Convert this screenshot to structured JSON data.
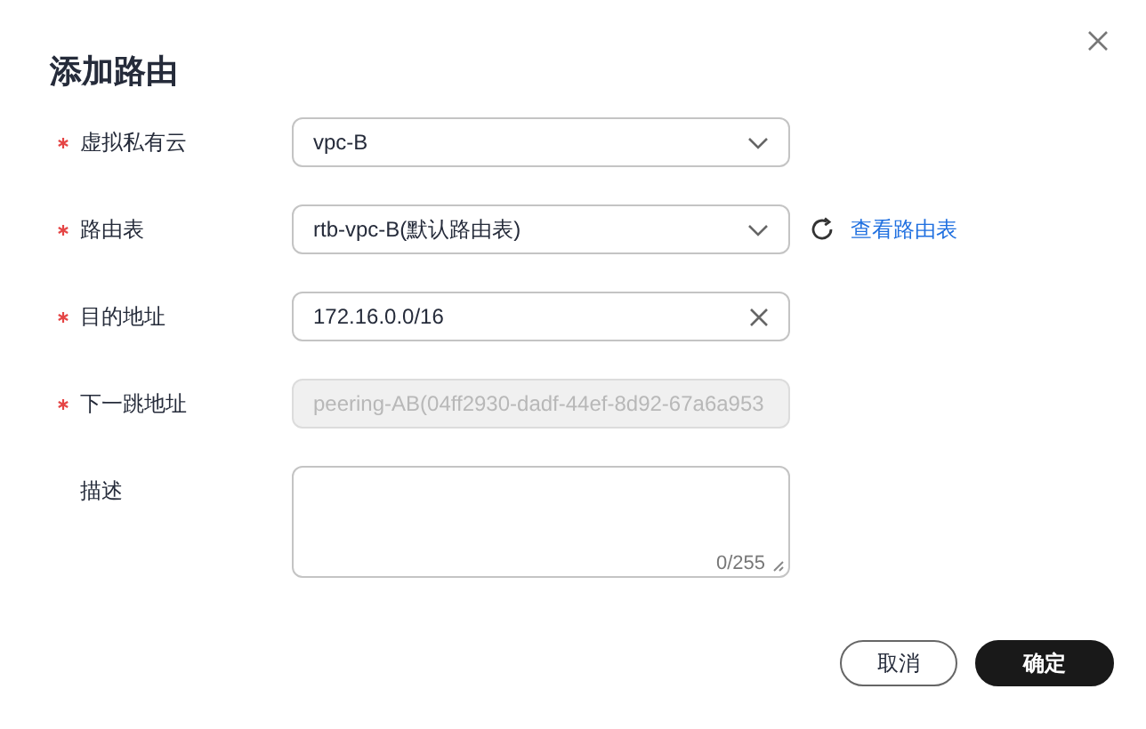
{
  "dialog": {
    "title": "添加路由"
  },
  "fields": [
    {
      "label": "虚拟私有云",
      "required": true,
      "kind": "select",
      "value": "vpc-B"
    },
    {
      "label": "路由表",
      "required": true,
      "kind": "select",
      "value": "rtb-vpc-B(默认路由表)",
      "link": "查看路由表"
    },
    {
      "label": "目的地址",
      "required": true,
      "kind": "input",
      "value": "172.16.0.0/16"
    },
    {
      "label": "下一跳地址",
      "required": true,
      "kind": "disabled",
      "value": "peering-AB(04ff2930-dadf-44ef-8d92-67a6a953"
    },
    {
      "label": "描述",
      "required": false,
      "kind": "textarea",
      "counter": "0/255"
    }
  ],
  "buttons": [
    {
      "label": "取消",
      "primary": false
    },
    {
      "label": "确定",
      "primary": true
    }
  ]
}
